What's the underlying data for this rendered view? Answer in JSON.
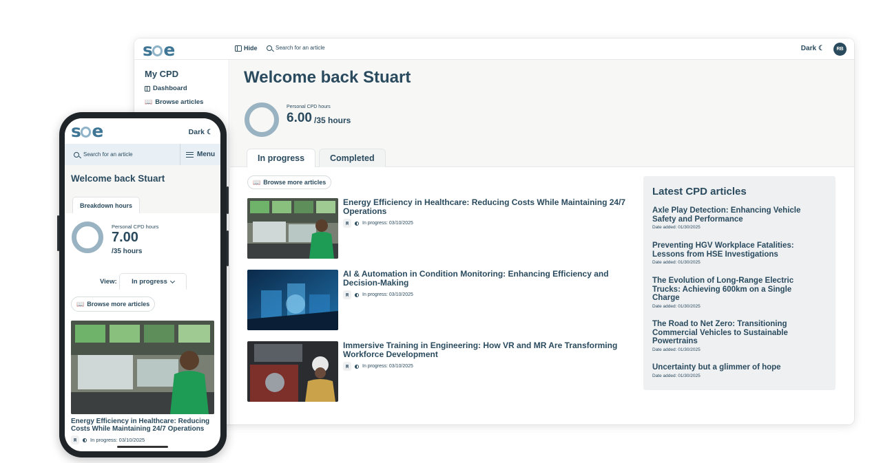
{
  "desktop": {
    "header": {
      "logo": "soe",
      "hide_label": "Hide",
      "search_placeholder": "Search for an article",
      "theme_label": "Dark",
      "avatar_initials": "RB"
    },
    "sidebar": {
      "heading": "My CPD",
      "items": [
        {
          "label": "Dashboard",
          "icon": "dashboard-icon"
        },
        {
          "label": "Browse articles",
          "icon": "book-icon"
        }
      ]
    },
    "main": {
      "welcome": "Welcome back Stuart",
      "cpd_label": "Personal CPD hours",
      "cpd_value": "6.00",
      "cpd_total": "/35 hours",
      "tabs": [
        {
          "label": "In progress",
          "active": true
        },
        {
          "label": "Completed",
          "active": false
        }
      ],
      "browse_label": "Browse more articles",
      "articles": [
        {
          "title": "Energy Efficiency in Healthcare: Reducing Costs While Maintaining 24/7 Operations",
          "status": "In progress: 03/10/2025"
        },
        {
          "title": "AI & Automation in Condition Monitoring: Enhancing Efficiency and Decision-Making",
          "status": "In progress: 03/10/2025"
        },
        {
          "title": "Immersive Training in Engineering: How VR and MR Are Transforming Workforce Development",
          "status": "In progress: 03/10/2025"
        }
      ]
    },
    "latest": {
      "heading": "Latest CPD articles",
      "items": [
        {
          "title": "Axle Play Detection: Enhancing Vehicle Safety and Performance",
          "date": "Date added: 01/30/2025"
        },
        {
          "title": "Preventing HGV Workplace Fatalities: Lessons from HSE Investigations",
          "date": "Date added: 01/30/2025"
        },
        {
          "title": "The Evolution of Long-Range Electric Trucks: Achieving 600km on a Single Charge",
          "date": "Date added: 01/30/2025"
        },
        {
          "title": "The Road to Net Zero: Transitioning Commercial Vehicles to Sustainable Powertrains",
          "date": "Date added: 01/30/2025"
        },
        {
          "title": "Uncertainty but a glimmer of hope",
          "date": "Date added: 01/30/2025"
        }
      ]
    }
  },
  "phone": {
    "logo": "soe",
    "theme_label": "Dark",
    "search_placeholder": "Search for an article",
    "menu_label": "Menu",
    "welcome": "Welcome back Stuart",
    "tab_label": "Breakdown hours",
    "cpd_label": "Personal CPD hours",
    "cpd_value": "7.00",
    "cpd_total": "/35 hours",
    "view_label": "View:",
    "view_selected": "In progress",
    "browse_label": "Browse more articles",
    "article": {
      "title": "Energy Efficiency in Healthcare: Reducing Costs While Maintaining 24/7 Operations",
      "status": "In progress: 03/10/2025"
    }
  },
  "colors": {
    "primary": "#2a4a5e",
    "accent": "#3f7696",
    "ring": "#9ab3c2",
    "panel": "#eef0f2"
  }
}
